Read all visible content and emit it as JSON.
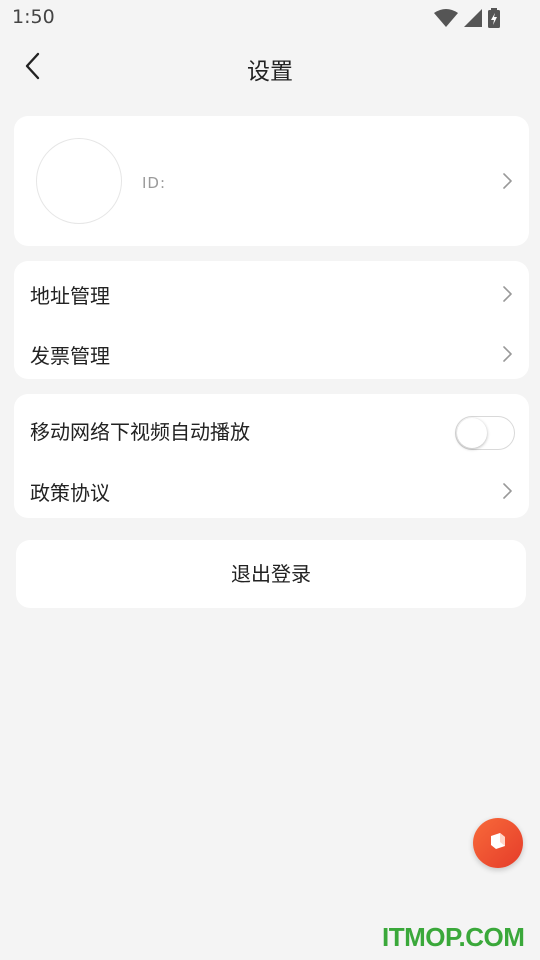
{
  "status_bar": {
    "time": "1:50",
    "icons": [
      "wifi-icon",
      "cellular-signal-icon",
      "battery-charging-icon"
    ]
  },
  "header": {
    "title": "设置",
    "back_icon": "chevron-left-icon"
  },
  "profile": {
    "id_label": "ID:"
  },
  "settings_group_1": [
    {
      "label": "地址管理",
      "icon": "chevron-right-icon"
    },
    {
      "label": "发票管理",
      "icon": "chevron-right-icon"
    }
  ],
  "settings_group_2": {
    "autoplay": {
      "label": "移动网络下视频自动播放",
      "enabled": false
    },
    "policy": {
      "label": "政策协议",
      "icon": "chevron-right-icon"
    }
  },
  "logout": {
    "label": "退出登录"
  },
  "floating_button": {
    "icon": "cube-icon",
    "color": "#f05a34"
  },
  "watermark": {
    "text": "ITMOP.COM",
    "color": "#3aa83a"
  },
  "colors": {
    "background": "#f4f4f4",
    "card": "#ffffff",
    "text": "#222222",
    "muted": "#9a9a9a"
  }
}
